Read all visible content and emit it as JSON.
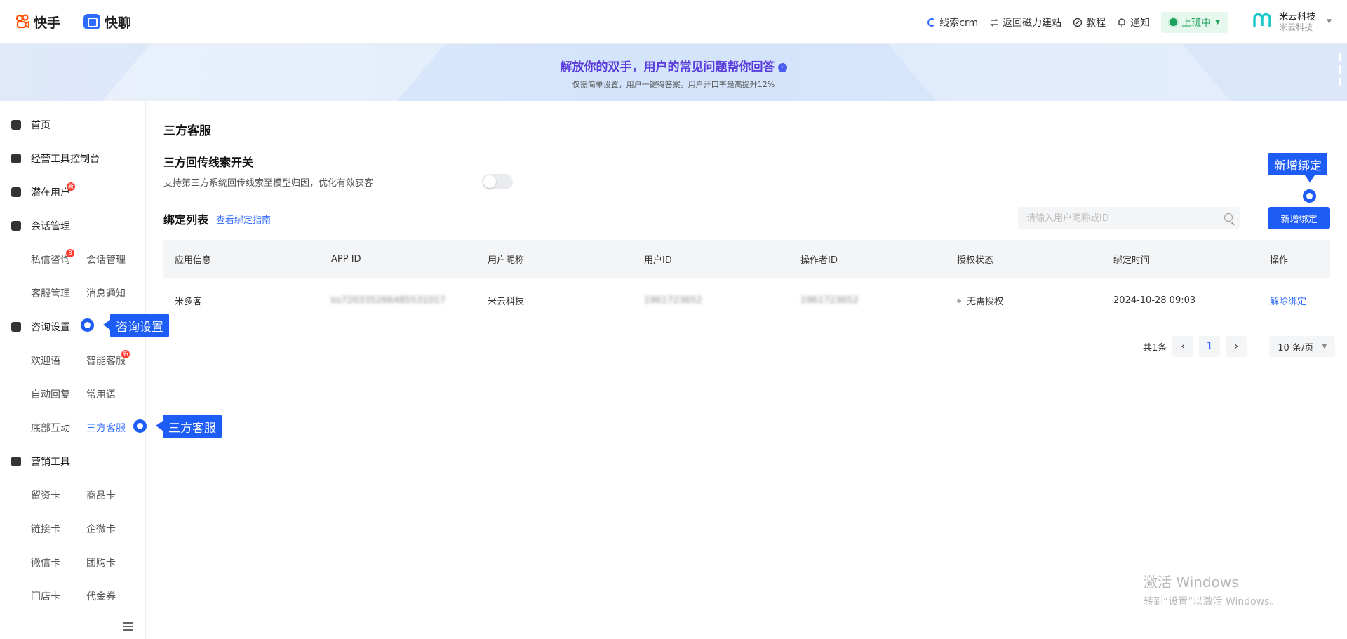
{
  "header": {
    "brand_kuaishou": "快手",
    "brand_kuailiao": "快聊",
    "links": [
      {
        "label": "线索crm",
        "icon": "crm-icon"
      },
      {
        "label": "返回磁力建站",
        "icon": "swap-icon"
      },
      {
        "label": "教程",
        "icon": "tutorial-icon"
      },
      {
        "label": "通知",
        "icon": "bell-icon"
      }
    ],
    "status": "上班中",
    "user_name": "米云科技",
    "user_org": "米云科技"
  },
  "banner": {
    "title": "解放你的双手，用户的常见问题帮你回答",
    "subtitle": "仅需简单设置，用户一键得答案。用户开口率最高提升12%"
  },
  "sidebar": {
    "home": "首页",
    "console": "经营工具控制台",
    "potential_users": "潜在用户",
    "potential_badge": "新",
    "session_mgmt": "会话管理",
    "dm": "私信咨询",
    "dm_badge": "8",
    "session_mgmt_sub": "会话管理",
    "cs_mgmt": "客服管理",
    "msg_notice": "消息通知",
    "consult_settings": "咨询设置",
    "welcome": "欢迎语",
    "smart_cs": "智能客服",
    "smart_badge": "新",
    "auto_reply": "自动回复",
    "common_phrases": "常用语",
    "bottom_interact": "底部互动",
    "third_party_cs": "三方客服",
    "marketing_tools": "营销工具",
    "lead_card": "留资卡",
    "product_card": "商品卡",
    "link_card": "链接卡",
    "wecom_card": "企微卡",
    "wechat_card": "微信卡",
    "group_buy_card": "团购卡",
    "store_card": "门店卡",
    "voucher": "代金券"
  },
  "main": {
    "page_title": "三方客服",
    "switch_title": "三方回传线索开关",
    "switch_desc": "支持第三方系统回传线索至模型归因，优化有效获客",
    "switch_on": false,
    "list_title": "绑定列表",
    "guide_link": "查看绑定指南",
    "search_placeholder": "请输入用户昵称或ID",
    "add_button": "新增绑定",
    "table": {
      "headers": [
        "应用信息",
        "APP ID",
        "用户昵称",
        "用户ID",
        "操作者ID",
        "授权状态",
        "绑定时间",
        "操作"
      ],
      "rows": [
        {
          "app": "米多客",
          "app_id": "ks720335266485531017",
          "nickname": "米云科技",
          "user_id": "1961723652",
          "operator_id": "1961723652",
          "auth": "无需授权",
          "time": "2024-10-28 09:03",
          "action": "解除绑定"
        }
      ]
    },
    "pager": {
      "total": "共1条",
      "prev": "‹",
      "page": "1",
      "next": "›",
      "size": "10 条/页"
    }
  },
  "callouts": {
    "consult": "咨询设置",
    "thirdparty": "三方客服",
    "add": "新增绑定"
  },
  "watermark": {
    "line1": "激活 Windows",
    "line2": "转到“设置”以激活 Windows。"
  },
  "colors": {
    "primary": "#1d5cf5",
    "status_green": "#1aa05a",
    "badge_red": "#ff3b30",
    "banner_title": "#5a3ddb"
  }
}
